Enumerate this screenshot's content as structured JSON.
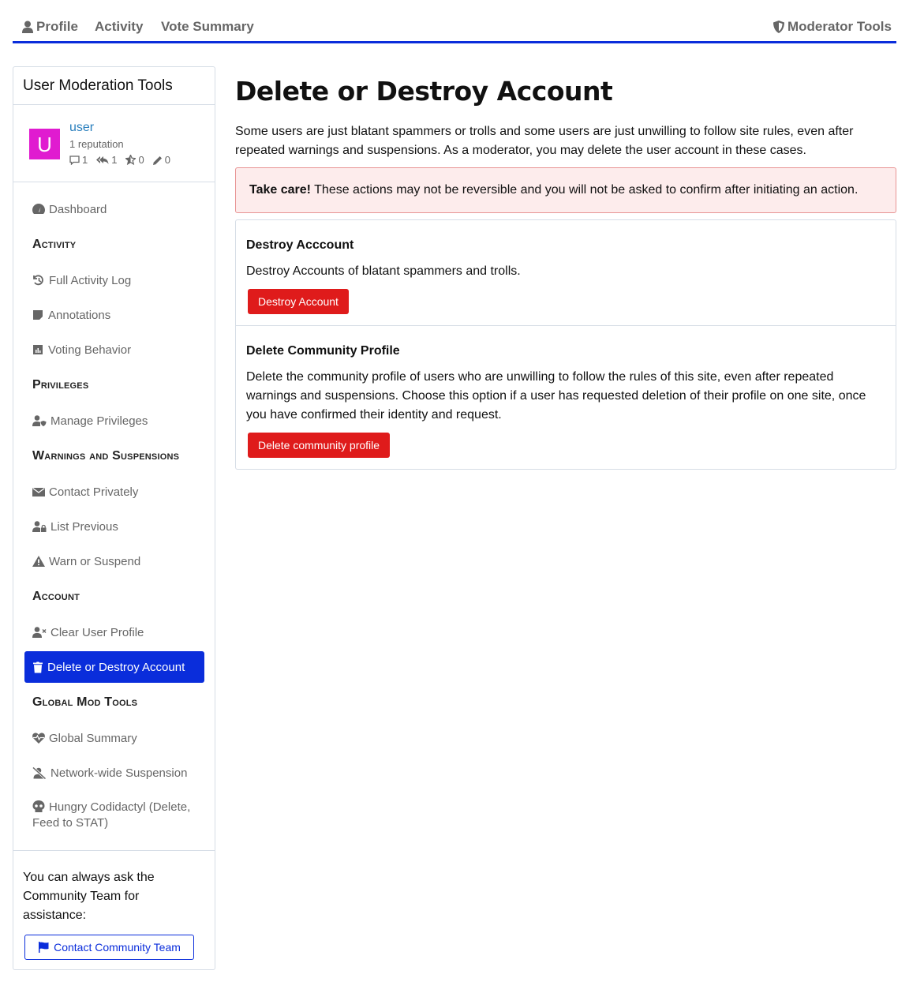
{
  "topnav": {
    "profile": "Profile",
    "activity": "Activity",
    "vote_summary": "Vote Summary",
    "moderator_tools": "Moderator Tools"
  },
  "sidebar": {
    "title": "User Moderation Tools",
    "user": {
      "avatar_letter": "U",
      "name": "user",
      "reputation": "1 reputation",
      "stats": {
        "posts": "1",
        "answers": "1",
        "votes": "0",
        "edits": "0"
      }
    },
    "dashboard": "Dashboard",
    "sections": {
      "activity": "Activity",
      "privileges": "Privileges",
      "warnings": "Warnings and Suspensions",
      "account": "Account",
      "global": "Global Mod Tools"
    },
    "items": {
      "full_activity_log": "Full Activity Log",
      "annotations": "Annotations",
      "voting_behavior": "Voting Behavior",
      "manage_privileges": "Manage Privileges",
      "contact_privately": "Contact Privately",
      "list_previous": "List Previous",
      "warn_or_suspend": "Warn or Suspend",
      "clear_user_profile": "Clear User Profile",
      "delete_or_destroy": "Delete or Destroy Account",
      "global_summary": "Global Summary",
      "network_suspension": "Network-wide Suspension",
      "hungry_codidactyl": "Hungry Codidactyl (Delete, Feed to STAT)"
    },
    "footer": {
      "text": "You can always ask the Community Team for assistance:",
      "button": "Contact Community Team"
    }
  },
  "main": {
    "title": "Delete or Destroy Account",
    "intro": "Some users are just blatant spammers or trolls and some users are just unwilling to follow site rules, even after repeated warnings and suspensions. As a moderator, you may delete the user account in these cases.",
    "alert": {
      "strong": "Take care!",
      "text": " These actions may not be reversible and you will not be asked to confirm after initiating an action."
    },
    "destroy": {
      "heading": "Destroy Acccount",
      "description": "Destroy Accounts of blatant spammers and trolls.",
      "button": "Destroy Account"
    },
    "delete_profile": {
      "heading": "Delete Community Profile",
      "description": "Delete the community profile of users who are unwilling to follow the rules of this site, even after repeated warnings and suspensions. Choose this option if a user has requested deletion of their profile on one site, once you have confirmed their identity and request.",
      "button": "Delete community profile"
    }
  },
  "colors": {
    "accent": "#0a2ddb",
    "danger": "#df1b1b",
    "alert_bg": "#fdecec",
    "avatar": "#e01bd0",
    "link": "#2a7fbd"
  }
}
